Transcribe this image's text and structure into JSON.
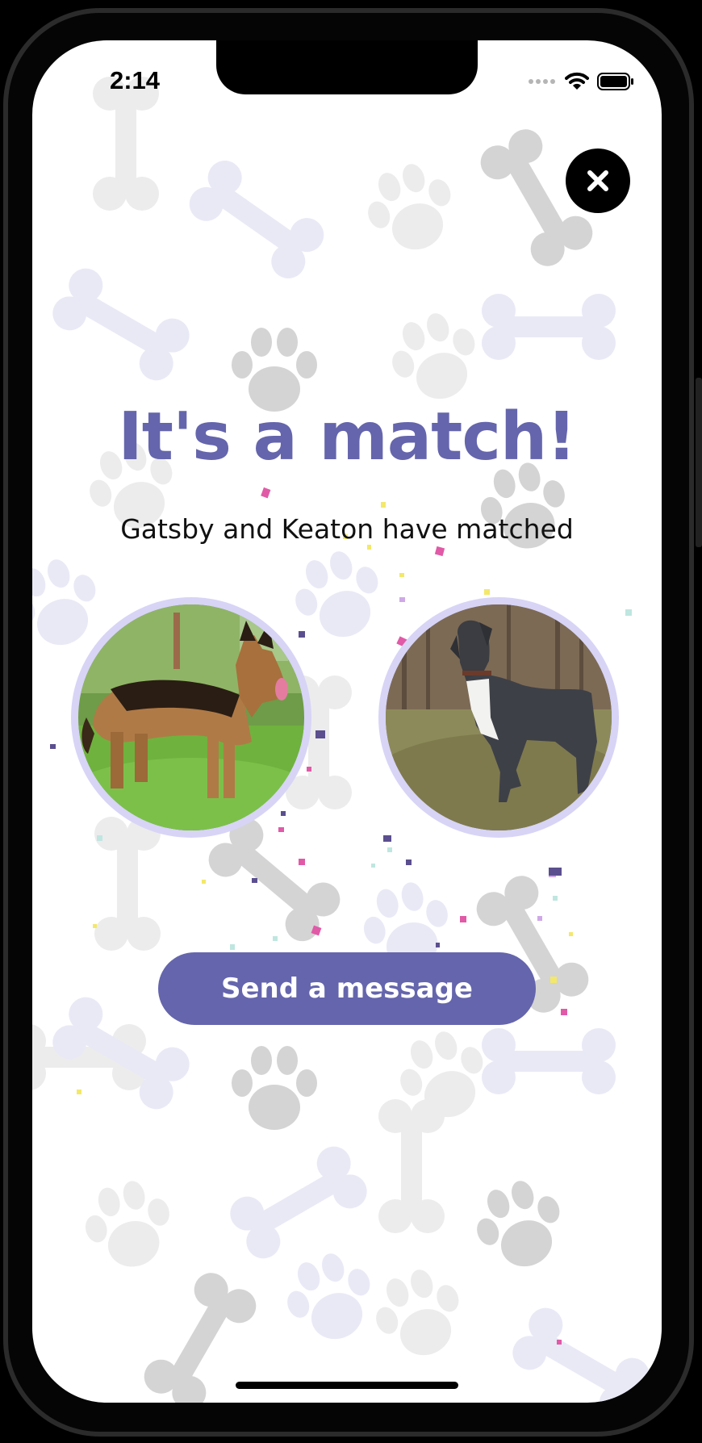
{
  "status_bar": {
    "time": "2:14",
    "icons": [
      "signal-dots-icon",
      "wifi-icon",
      "battery-icon"
    ]
  },
  "match": {
    "title": "It's a match!",
    "subtitle": "Gatsby and Keaton have matched",
    "pets": [
      {
        "name": "Gatsby",
        "breed_shown": "German Shepherd"
      },
      {
        "name": "Keaton",
        "breed_shown": "Great Dane"
      }
    ]
  },
  "actions": {
    "close_icon": "close-icon",
    "send_message_label": "Send a message"
  },
  "colors": {
    "accent": "#6565ad",
    "photo_ring": "#d7d4f6",
    "close_bg": "#000000",
    "background": "#ffffff"
  }
}
